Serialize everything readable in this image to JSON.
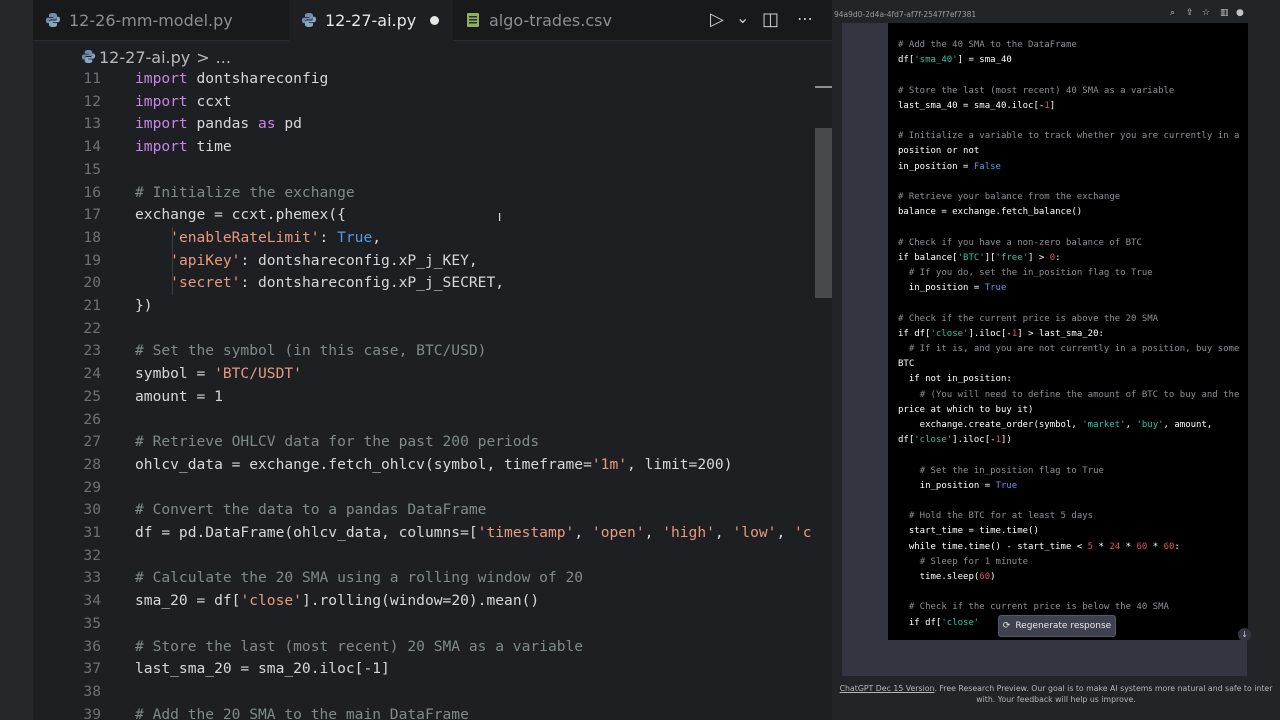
{
  "editor": {
    "tabs": [
      {
        "label": "12-26-mm-model.py",
        "type": "python"
      },
      {
        "label": "12-27-ai.py",
        "type": "python",
        "active": true,
        "modified": true
      },
      {
        "label": "algo-trades.csv",
        "type": "csv"
      }
    ],
    "actions": {
      "run": "▷",
      "run_menu": "⌄",
      "split": "◫",
      "more": "⋯"
    },
    "breadcrumb": {
      "file": "12-27-ai.py",
      "sep": ">",
      "rest": "..."
    },
    "lines": [
      {
        "n": "11",
        "text": "import dontshareconfig"
      },
      {
        "n": "12",
        "text": "import ccxt"
      },
      {
        "n": "13",
        "text": "import pandas as pd"
      },
      {
        "n": "14",
        "text": "import time"
      },
      {
        "n": "15",
        "text": ""
      },
      {
        "n": "16",
        "text": "# Initialize the exchange"
      },
      {
        "n": "17",
        "text": "exchange = ccxt.phemex({"
      },
      {
        "n": "18",
        "text": "    'enableRateLimit': True,"
      },
      {
        "n": "19",
        "text": "    'apiKey': dontshareconfig.xP_j_KEY,"
      },
      {
        "n": "20",
        "text": "    'secret': dontshareconfig.xP_j_SECRET,"
      },
      {
        "n": "21",
        "text": "})"
      },
      {
        "n": "22",
        "text": ""
      },
      {
        "n": "23",
        "text": "# Set the symbol (in this case, BTC/USD)"
      },
      {
        "n": "24",
        "text": "symbol = 'BTC/USDT'"
      },
      {
        "n": "25",
        "text": "amount = 1"
      },
      {
        "n": "26",
        "text": ""
      },
      {
        "n": "27",
        "text": "# Retrieve OHLCV data for the past 200 periods"
      },
      {
        "n": "28",
        "text": "ohlcv_data = exchange.fetch_ohlcv(symbol, timeframe='1m', limit=200)"
      },
      {
        "n": "29",
        "text": ""
      },
      {
        "n": "30",
        "text": "# Convert the data to a pandas DataFrame"
      },
      {
        "n": "31",
        "text": "df = pd.DataFrame(ohlcv_data, columns=['timestamp', 'open', 'high', 'low', 'c"
      },
      {
        "n": "32",
        "text": ""
      },
      {
        "n": "33",
        "text": "# Calculate the 20 SMA using a rolling window of 20"
      },
      {
        "n": "34",
        "text": "sma_20 = df['close'].rolling(window=20).mean()"
      },
      {
        "n": "35",
        "text": ""
      },
      {
        "n": "36",
        "text": "# Store the last (most recent) 20 SMA as a variable"
      },
      {
        "n": "37",
        "text": "last_sma_20 = sma_20.iloc[-1]"
      },
      {
        "n": "38",
        "text": ""
      },
      {
        "n": "39",
        "text": "# Add the 20 SMA to the main DataFrame"
      }
    ]
  },
  "browser": {
    "url": "94a9d0-2d4a-4fd7-af7f-2547f7ef7381",
    "toolbar_icons": [
      "search-icon",
      "share-icon",
      "star-icon",
      "sidebar-icon",
      "profile-icon"
    ],
    "code_lines": [
      "# Add the 40 SMA to the DataFrame",
      "df['sma_40'] = sma_40",
      "",
      "# Store the last (most recent) 40 SMA as a variable",
      "last_sma_40 = sma_40.iloc[-1]",
      "",
      "# Initialize a variable to track whether you are currently in a",
      "position or not",
      "in_position = False",
      "",
      "# Retrieve your balance from the exchange",
      "balance = exchange.fetch_balance()",
      "",
      "# Check if you have a non-zero balance of BTC",
      "if balance['BTC']['free'] > 0:",
      "  # If you do, set the in_position flag to True",
      "  in_position = True",
      "",
      "# Check if the current price is above the 20 SMA",
      "if df['close'].iloc[-1] > last_sma_20:",
      "  # If it is, and you are not currently in a position, buy some",
      "BTC",
      "  if not in_position:",
      "    # (You will need to define the amount of BTC to buy and the",
      "price at which to buy it)",
      "    exchange.create_order(symbol, 'market', 'buy', amount,",
      "df['close'].iloc[-1])",
      "",
      "    # Set the in_position flag to True",
      "    in_position = True",
      "",
      "  # Hold the BTC for at least 5 days",
      "  start_time = time.time()",
      "  while time.time() - start_time < 5 * 24 * 60 * 60:",
      "    # Sleep for 1 minute",
      "    time.sleep(60)",
      "",
      "  # Check if the current price is below the 40 SMA",
      "  if df['close'"
    ],
    "regenerate_label": "Regenerate response",
    "footer_link": "ChatGPT Dec 15 Version",
    "footer_text": ". Free Research Preview. Our goal is to make AI systems more natural and safe to inter",
    "footer_text2": "with. Your feedback will help us improve."
  },
  "colors": {
    "editor_bg": "#1e1f22",
    "keyword": "#c586e6",
    "comment": "#7f8a8d",
    "string": "#e79a7e",
    "boolean": "#4f9ce6",
    "chat_code_bg": "#000000",
    "chat_string": "#2ec3a6",
    "chat_number": "#e24e6b"
  }
}
